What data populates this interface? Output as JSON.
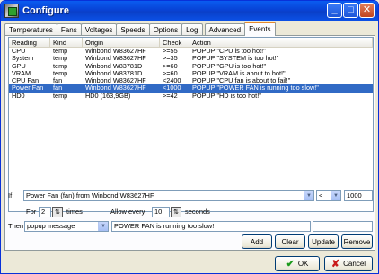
{
  "window": {
    "title": "Configure"
  },
  "tabs": [
    {
      "label": "Temperatures"
    },
    {
      "label": "Fans"
    },
    {
      "label": "Voltages"
    },
    {
      "label": "Speeds"
    },
    {
      "label": "Options"
    },
    {
      "label": "Log"
    },
    {
      "label": "Advanced"
    },
    {
      "label": "Events",
      "active": true
    }
  ],
  "events_table": {
    "columns": [
      "Reading",
      "Kind",
      "Origin",
      "Check",
      "Action"
    ],
    "rows": [
      [
        "CPU",
        "temp",
        "Winbond W83627HF",
        ">=55",
        "POPUP \"CPU is too hot!\""
      ],
      [
        "System",
        "temp",
        "Winbond W83627HF",
        ">=35",
        "POPUP \"SYSTEM is too hot!\""
      ],
      [
        "GPU",
        "temp",
        "Winbond W83781D",
        ">=60",
        "POPUP \"GPU is too hot!\""
      ],
      [
        "VRAM",
        "temp",
        "Winbond W83781D",
        ">=60",
        "POPUP \"VRAM is about to hot!\""
      ],
      [
        "CPU Fan",
        "fan",
        "Winbond W83627HF",
        "<2400",
        "POPUP \"CPU fan is about to fail!\""
      ],
      [
        "Power Fan",
        "fan",
        "Winbond W83627HF",
        "<1000",
        "POPUP \"POWER FAN is running too slow!\""
      ],
      [
        "HD0",
        "temp",
        "HD0 (163,9GB)",
        ">=42",
        "POPUP \"HD is too hot!\""
      ]
    ],
    "selected_index": 5
  },
  "editor": {
    "if_label": "If",
    "reading_value": "Power Fan (fan) from Winbond W83627HF",
    "operator_value": "<",
    "threshold_value": "1000",
    "for_label": "For",
    "for_value": "2",
    "times_label": "times",
    "allow_label": "Allow every",
    "allow_value": "10",
    "seconds_label": "seconds",
    "then_label": "Then",
    "action_value": "popup message",
    "message_value": "POWER FAN is running too slow!",
    "extra_value": ""
  },
  "buttons": {
    "add": "Add",
    "clear": "Clear",
    "update": "Update",
    "remove": "Remove",
    "ok": "OK",
    "cancel": "Cancel"
  },
  "colors": {
    "selection": "#316ac5",
    "titlebar": "#0a4be0"
  }
}
